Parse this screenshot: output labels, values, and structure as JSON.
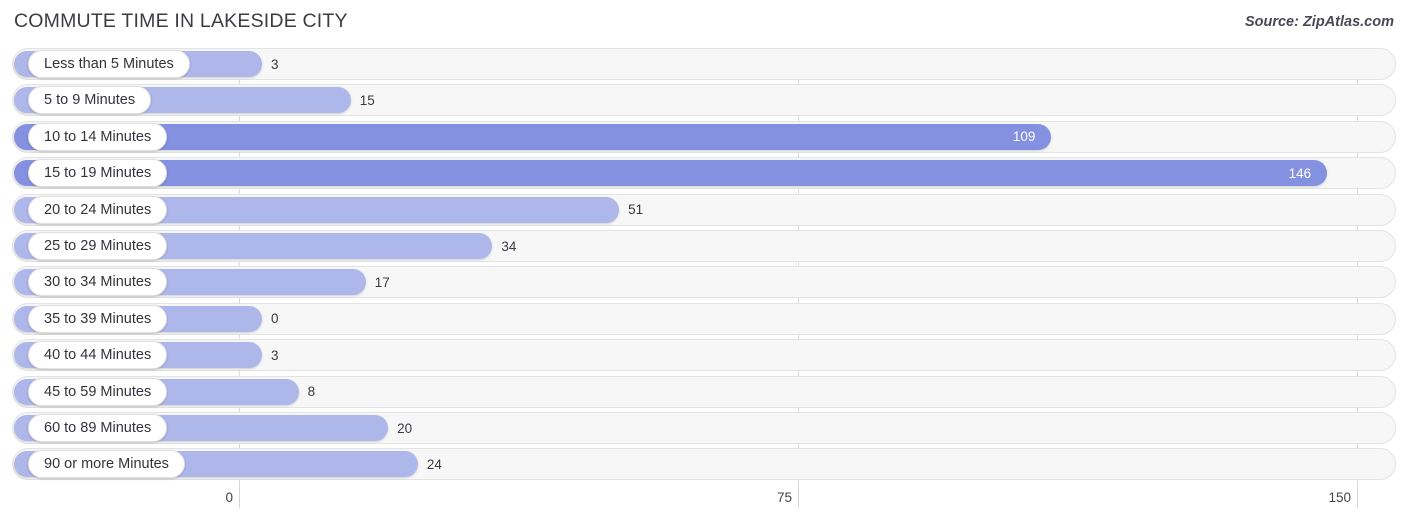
{
  "header": {
    "title": "COMMUTE TIME IN LAKESIDE CITY",
    "source": "Source: ZipAtlas.com"
  },
  "chart_data": {
    "type": "bar",
    "orientation": "horizontal",
    "title": "COMMUTE TIME IN LAKESIDE CITY",
    "xlabel": "",
    "ylabel": "",
    "xlim": [
      0,
      150
    ],
    "xticks": [
      0,
      75,
      150
    ],
    "xtick_labels": [
      "0",
      "75",
      "150"
    ],
    "grid": true,
    "legend": false,
    "categories": [
      "Less than 5 Minutes",
      "5 to 9 Minutes",
      "10 to 14 Minutes",
      "15 to 19 Minutes",
      "20 to 24 Minutes",
      "25 to 29 Minutes",
      "30 to 34 Minutes",
      "35 to 39 Minutes",
      "40 to 44 Minutes",
      "45 to 59 Minutes",
      "60 to 89 Minutes",
      "90 or more Minutes"
    ],
    "values": [
      3,
      15,
      109,
      146,
      51,
      34,
      17,
      0,
      3,
      8,
      20,
      24
    ],
    "value_labels": [
      "3",
      "15",
      "109",
      "146",
      "51",
      "34",
      "17",
      "0",
      "3",
      "8",
      "20",
      "24"
    ],
    "colors": {
      "bar_light": "#aeb7ea",
      "bar_dark": "#8490e0",
      "track": "#f7f7f7",
      "track_border": "#e3e3e3",
      "gridline": "#d8d8dd",
      "label_pill": "#ffffff",
      "text": "#3a3a42",
      "inside_label_text": "#ffffff"
    }
  }
}
